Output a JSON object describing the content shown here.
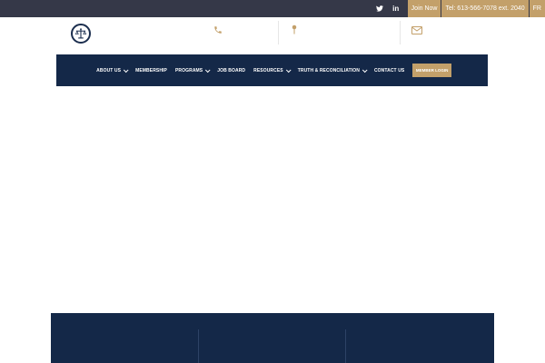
{
  "topbar": {
    "social": [
      {
        "name": "twitter-icon"
      },
      {
        "name": "linkedin-icon",
        "glyph": "in"
      }
    ],
    "join_label": "Join Now",
    "phone_label": "Tel: 613-566-7078 ext. 2040",
    "lang_label": "FR"
  },
  "nav": {
    "items": [
      {
        "label": "ABOUT US",
        "dropdown": true
      },
      {
        "label": "MEMBERSHIP",
        "dropdown": false
      },
      {
        "label": "PROGRAMS",
        "dropdown": true
      },
      {
        "label": "JOB BOARD",
        "dropdown": false
      },
      {
        "label": "RESOURCES",
        "dropdown": true
      },
      {
        "label": "TRUTH & RECONCILIATION",
        "dropdown": true
      },
      {
        "label": "CONTACT US",
        "dropdown": false
      }
    ],
    "login_label": "MEMBER LOGIN"
  },
  "colors": {
    "topbar": "#353848",
    "accent_gold": "#c3a06a",
    "navy": "#142848"
  }
}
